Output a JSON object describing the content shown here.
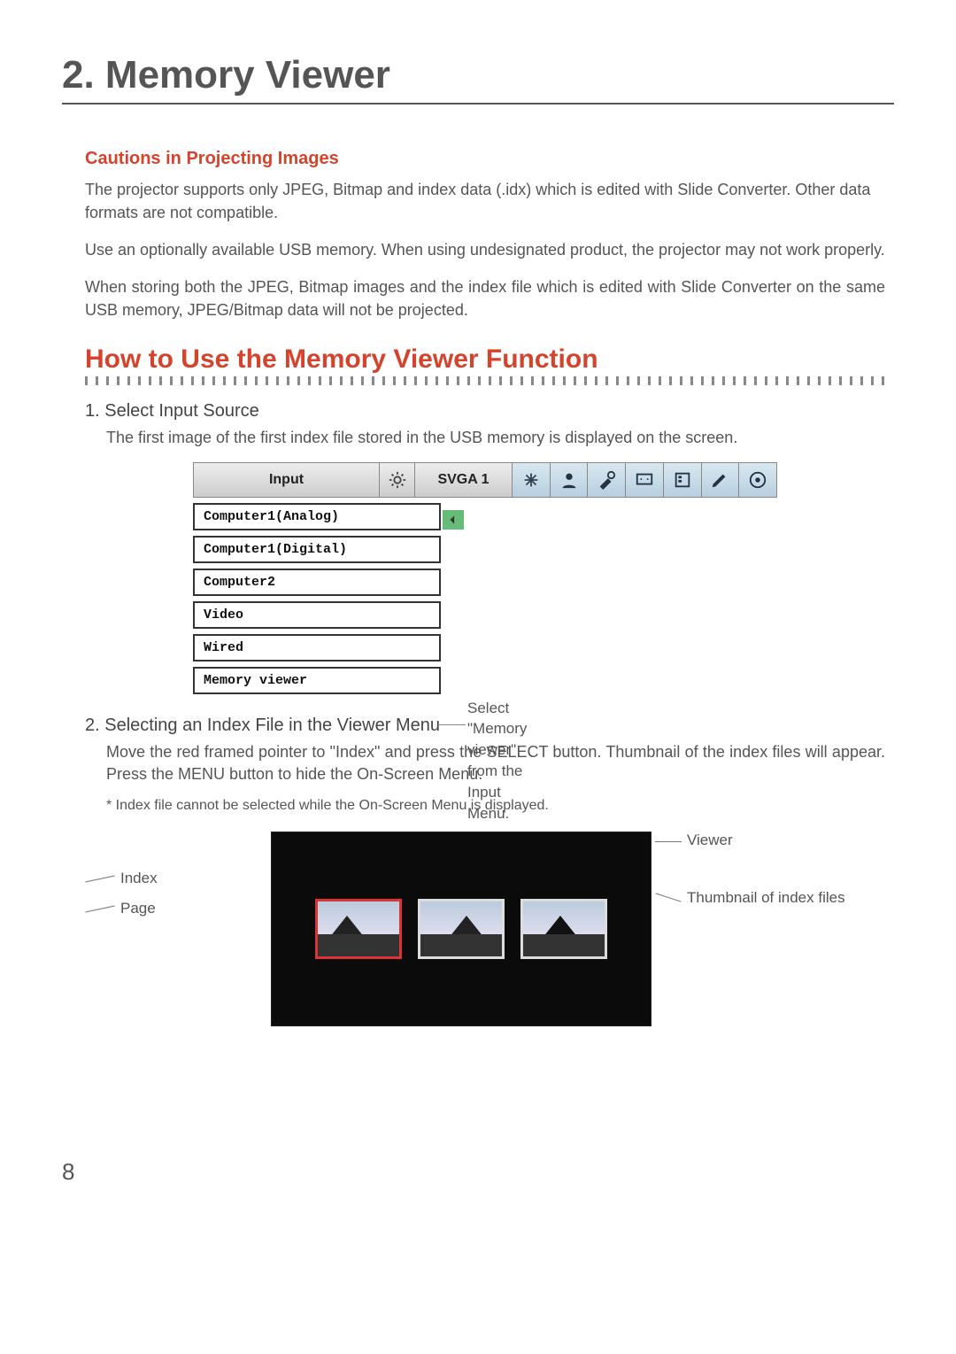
{
  "chapter_title": "2. Memory Viewer",
  "cautions": {
    "heading": "Cautions in Projecting Images",
    "para1": "The projector supports only JPEG, Bitmap and index data (.idx) which is edited with Slide Converter.  Other data formats are not compatible.",
    "para2": "Use an optionally available USB memory.  When using undesignated product, the projector may not work properly.",
    "para3": "When storing both the JPEG, Bitmap images and the index file which is edited with Slide Converter on the same USB memory, JPEG/Bitmap data will not be projected."
  },
  "howto": {
    "heading": "How to Use the Memory Viewer Function",
    "step1_head": "1. Select Input Source",
    "step1_desc": "The first image of the first index file stored in the USB memory is displayed on the screen.",
    "step2_head": "2. Selecting an Index File in the Viewer Menu",
    "step2_desc": "Move the red framed pointer to \"Index\" and press the SELECT button.  Thumbnail of the index files will appear.  Press the MENU button to hide the On-Screen Menu.",
    "step2_note": "* Index file cannot be selected while the On-Screen Menu is displayed."
  },
  "menu": {
    "title": "Input",
    "mode": "SVGA 1",
    "icon_names": [
      "nav",
      "person",
      "tools",
      "screen",
      "list",
      "pencil",
      "disc"
    ],
    "sources": [
      "Computer1(Analog)",
      "Computer1(Digital)",
      "Computer2",
      "Video",
      "Wired",
      "Memory viewer"
    ],
    "callout_line1": "Select \"Memory viewer\"",
    "callout_line2": "from the Input Menu."
  },
  "viewer_labels": {
    "index": "Index",
    "page": "Page",
    "viewer": "Viewer",
    "thumbnail": "Thumbnail of index files"
  },
  "page_number": "8"
}
